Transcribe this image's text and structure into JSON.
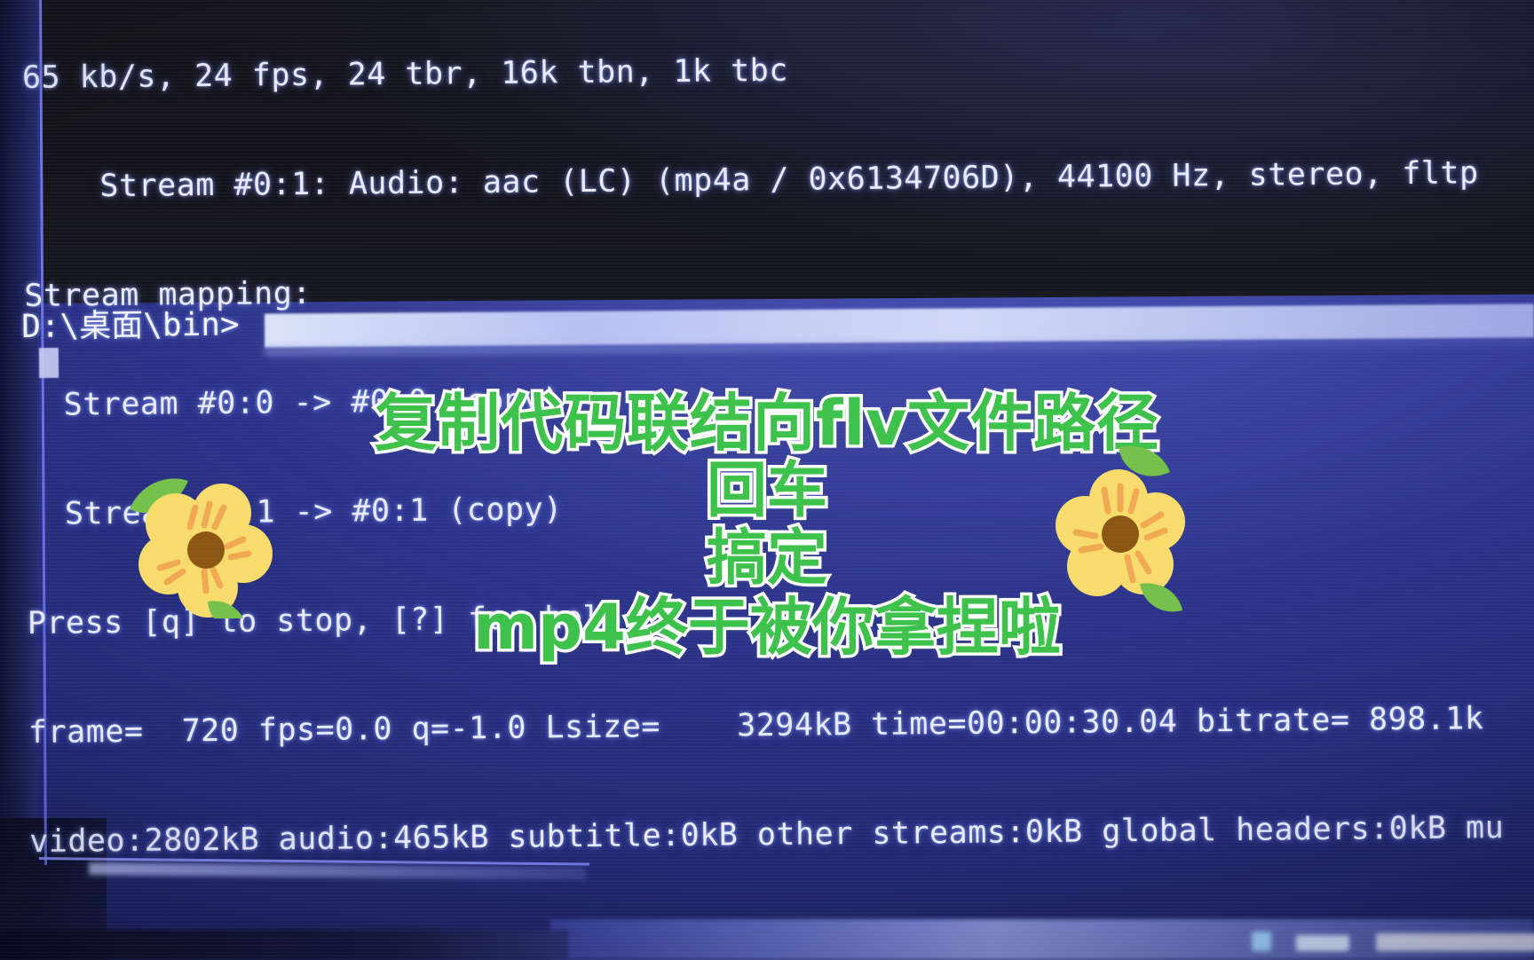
{
  "scene": {
    "kind": "photo-of-monitor",
    "description": "Windows command prompt showing ffmpeg remux output with Chinese tutorial caption overlay"
  },
  "colors": {
    "desktop_blue": "#3a42a6",
    "console_background": "#15151c",
    "console_text": "#e8eaff",
    "caption_green": "#3cc14a",
    "caption_outline": "#ffffff",
    "flower_petal": "#f7dc6b",
    "flower_center": "#8a5512",
    "flower_stroke": "#f0a952",
    "leaf_green": "#6fc04a",
    "window_border": "#7f86ff"
  },
  "console": {
    "lines": [
      "65 kb/s, 24 fps, 24 tbr, 16k tbn, 1k tbc",
      "    Stream #0:1: Audio: aac (LC) (mp4a / 0x6134706D), 44100 Hz, stereo, fltp",
      "Stream mapping:",
      "  Stream #0:0 -> #0:0 (copy)",
      "  Stream #0:1 -> #0:1 (copy)",
      "Press [q] to stop, [?] for help",
      "frame=  720 fps=0.0 q=-1.0 Lsize=    3294kB time=00:00:30.04 bitrate= 898.1k",
      "video:2802kB audio:465kB subtitle:0kB other streams:0kB global headers:0kB mu"
    ],
    "prompt": "D:\\桌面\\bin>",
    "cursor": "block-cursor"
  },
  "stats": {
    "bitrate_kbs": "65 kb/s",
    "fps": "24 fps",
    "tbr": "24 tbr",
    "tbn": "16k tbn",
    "tbc": "1k tbc",
    "audio_codec": "aac (LC)",
    "audio_tag": "mp4a / 0x6134706D",
    "sample_rate": "44100 Hz",
    "channels": "stereo",
    "sample_fmt": "fltp",
    "frame_count": "720",
    "encode_fps": "0.0",
    "q": "-1.0",
    "lsize": "3294kB",
    "time": "00:00:30.04",
    "out_bitrate": "898.1k",
    "video_size": "2802kB",
    "audio_size": "465kB",
    "subtitle_size": "0kB",
    "other_streams_size": "0kB",
    "global_headers_size": "0kB"
  },
  "captions": {
    "line1": "复制代码联结向flv文件路径",
    "line2": "回车",
    "line3": "搞定",
    "line4": "mp4终于被你拿捏啦"
  },
  "decorations": {
    "flower_left": "flower-sticker",
    "flower_right": "flower-sticker",
    "leaf_left": "leaf-icon",
    "leaf_right": "leaf-icon"
  },
  "taskbar": {
    "label": "windows-taskbar-blurred"
  }
}
